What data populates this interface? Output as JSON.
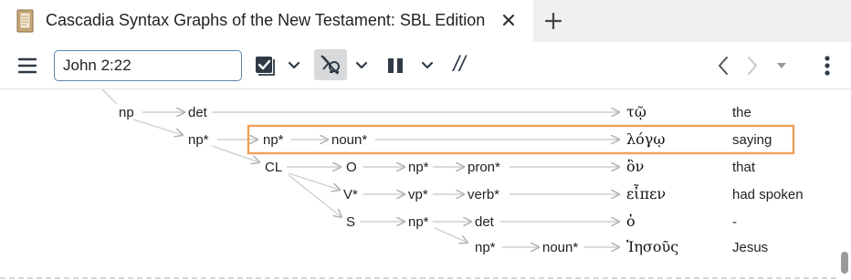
{
  "tab": {
    "title": "Cascadia Syntax Graphs of the New Testament: SBL Edition",
    "icon": "book-icon"
  },
  "toolbar": {
    "reference": "John 2:22",
    "parallel_label": "//"
  },
  "graph": {
    "nodes": {
      "top_np": "np",
      "det_1": "det",
      "np_star_1": "np*",
      "np_star_2": "np*",
      "noun_star_1": "noun*",
      "cl": "CL",
      "o": "O",
      "np_star_3": "np*",
      "pron_star": "pron*",
      "v_star": "V*",
      "vp_star": "vp*",
      "verb_star": "verb*",
      "s": "S",
      "np_star_4": "np*",
      "det_2": "det",
      "np_star_5": "np*",
      "noun_star_2": "noun*"
    },
    "words": [
      {
        "greek": "τῷ",
        "gloss": "the"
      },
      {
        "greek": "λόγῳ",
        "gloss": "saying"
      },
      {
        "greek": "ὃν",
        "gloss": "that"
      },
      {
        "greek": "εἶπεν",
        "gloss": "had spoken"
      },
      {
        "greek": "ὁ",
        "gloss": "-"
      },
      {
        "greek": "Ἰησοῦς",
        "gloss": "Jesus"
      }
    ],
    "highlight_color": "#f0a05a"
  }
}
